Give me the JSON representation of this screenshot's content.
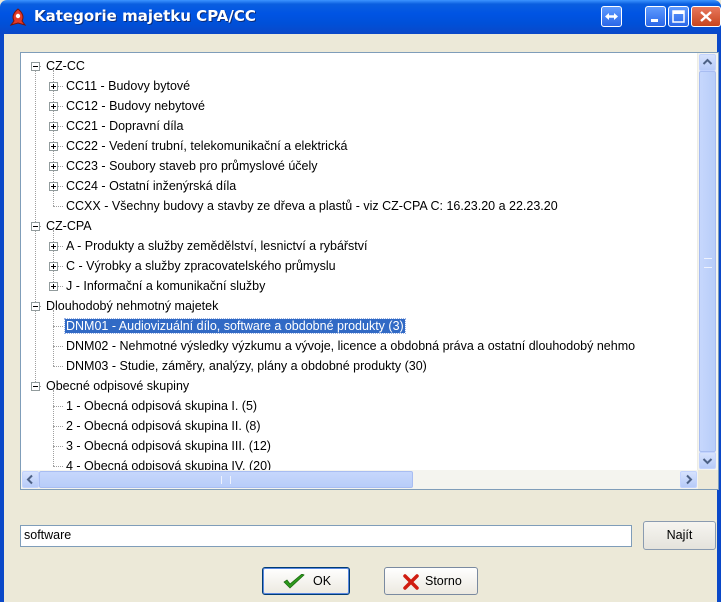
{
  "window": {
    "title": "Kategorie majetku CPA/CC",
    "controls": [
      "expand-arrows-icon",
      "minimize-icon",
      "maximize-icon",
      "close-icon"
    ]
  },
  "tree": {
    "nodes": [
      {
        "label": "CZ-CC",
        "expander": "minus",
        "level": 0
      },
      {
        "label": "CC11 - Budovy bytové",
        "expander": "plus",
        "level": 1
      },
      {
        "label": "CC12 - Budovy nebytové",
        "expander": "plus",
        "level": 1
      },
      {
        "label": "CC21 - Dopravní díla",
        "expander": "plus",
        "level": 1
      },
      {
        "label": "CC22 - Vedení trubní, telekomunikační a elektrická",
        "expander": "plus",
        "level": 1
      },
      {
        "label": "CC23 - Soubory staveb pro průmyslové účely",
        "expander": "plus",
        "level": 1
      },
      {
        "label": "CC24 - Ostatní inženýrská díla",
        "expander": "plus",
        "level": 1
      },
      {
        "label": "CCXX - Všechny budovy a stavby ze dřeva a plastů - viz CZ-CPA C: 16.23.20 a 22.23.20",
        "expander": "none",
        "level": 1
      },
      {
        "label": "CZ-CPA",
        "expander": "minus",
        "level": 0
      },
      {
        "label": "A - Produkty a služby zemědělství, lesnictví a rybářství",
        "expander": "plus",
        "level": 1
      },
      {
        "label": "C - Výrobky a služby zpracovatelského průmyslu",
        "expander": "plus",
        "level": 1
      },
      {
        "label": "J - Informační a komunikační služby",
        "expander": "plus",
        "level": 1
      },
      {
        "label": "Dlouhodobý nehmotný majetek",
        "expander": "minus",
        "level": 0
      },
      {
        "label": "DNM01 - Audiovizuální dílo, software a obdobné produkty (3)",
        "expander": "none",
        "level": 1,
        "selected": true
      },
      {
        "label": "DNM02 - Nehmotné výsledky výzkumu a vývoje, licence a obdobná práva a ostatní dlouhodobý nehmo",
        "expander": "none",
        "level": 1
      },
      {
        "label": "DNM03 - Studie, záměry, analýzy, plány a obdobné produkty (30)",
        "expander": "none",
        "level": 1
      },
      {
        "label": "Obecné odpisové skupiny",
        "expander": "minus",
        "level": 0
      },
      {
        "label": "1 - Obecná odpisová skupina I. (5)",
        "expander": "none",
        "level": 1
      },
      {
        "label": "2 - Obecná odpisová skupina II. (8)",
        "expander": "none",
        "level": 1
      },
      {
        "label": "3 - Obecná odpisová skupina III. (12)",
        "expander": "none",
        "level": 1
      },
      {
        "label": "4 - Obecná odpisová skupina IV. (20)",
        "expander": "none",
        "level": 1
      }
    ]
  },
  "search": {
    "value": "software"
  },
  "buttons": {
    "find": "Najít",
    "ok": "OK",
    "cancel": "Storno"
  },
  "colors": {
    "selection": "#316ac5",
    "titlebar": "#0054e3",
    "face": "#ece9d8"
  }
}
